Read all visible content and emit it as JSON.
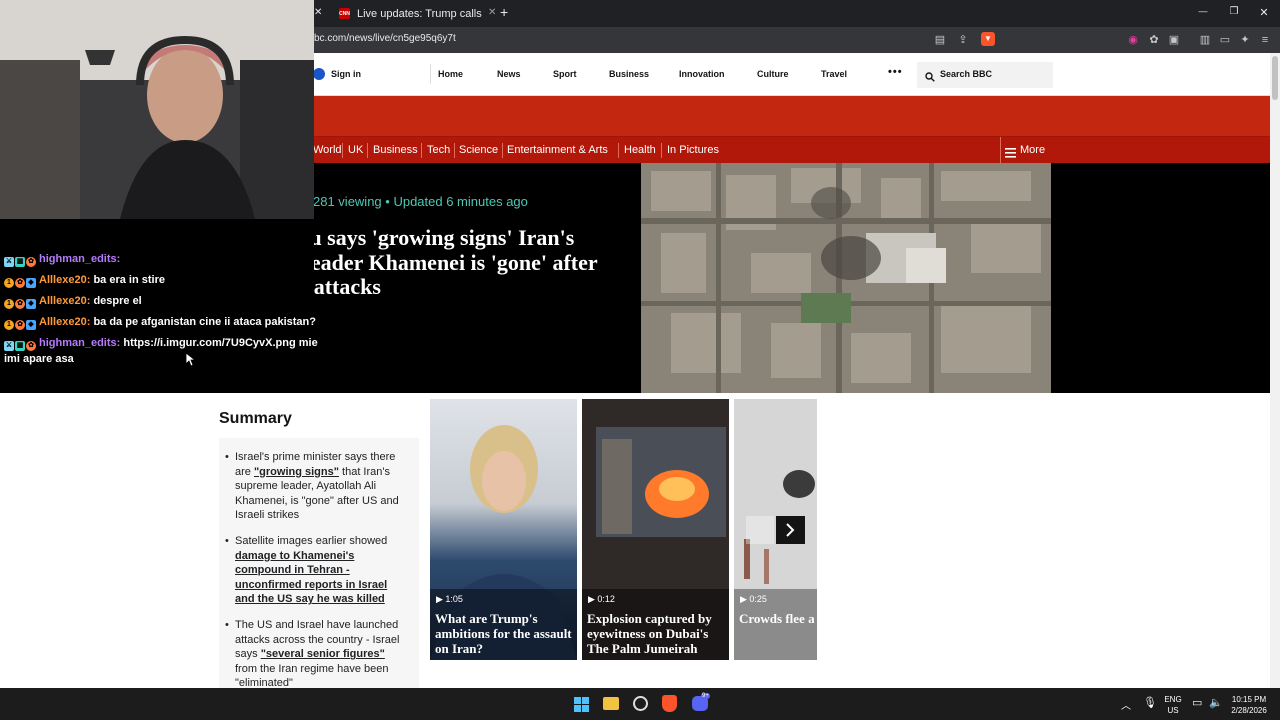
{
  "browser": {
    "tabs": [
      {
        "label": "Live updates: Trump calls for regime"
      }
    ],
    "new_tab_label": "+",
    "url": "bc.com/news/live/cn5ge95q6y7t",
    "window_controls": {
      "minimize": "—",
      "restore": "❐",
      "close": "✕"
    }
  },
  "bbc": {
    "sign_in": "Sign in",
    "nav": [
      "Home",
      "News",
      "Sport",
      "Business",
      "Innovation",
      "Culture",
      "Travel"
    ],
    "more_dots": "•••",
    "search_placeholder": "Search BBC",
    "subnav": [
      "World",
      "UK",
      "Business",
      "Tech",
      "Science",
      "Entertainment & Arts",
      "Health",
      "In Pictures"
    ],
    "more_label": "More",
    "viewing": "281 viewing",
    "updated": "Updated 6 minutes ago",
    "headline": "Netanyahu says 'growing signs' Iran's supreme leader Khamenei is 'gone' after US-Israel attacks",
    "summary_title": "Summary",
    "summary_bullets": [
      {
        "before": "Israel's prime minister says there are ",
        "link": "\"growing signs\"",
        "after": " that Iran's supreme leader, Ayatollah Ali Khamenei, is \"gone\" after US and Israeli strikes"
      },
      {
        "before": "Satellite images earlier showed ",
        "link": "damage to Khamenei's compound in Tehran - unconfirmed reports in Israel and the US say he was killed",
        "after": ""
      },
      {
        "before": "The US and Israel have launched attacks across the country - Israel says ",
        "link": "\"several senior figures\"",
        "after": " from the Iran regime have been \"eliminated\""
      }
    ],
    "videos": [
      {
        "duration": "1:05",
        "title": "What are Trump's ambitions for the assault on Iran?"
      },
      {
        "duration": "0:12",
        "title": "Explosion captured by eyewitness on Dubai's The Palm Jumeirah"
      },
      {
        "duration": "0:25",
        "title": "Crowds flee a object sparks in Doha"
      }
    ]
  },
  "chat": {
    "messages": [
      {
        "user": "highman_edits:",
        "text": "",
        "color": "#b57bff"
      },
      {
        "user": "Alllexe20:",
        "text": "ba era in stire",
        "color": "#ff9a3c"
      },
      {
        "user": "Alllexe20:",
        "text": "despre el",
        "color": "#ff9a3c"
      },
      {
        "user": "Alllexe20:",
        "text": "ba da pe afganistan cine ii ataca pakistan?",
        "color": "#ff9a3c"
      },
      {
        "user": "highman_edits:",
        "text": "https://i.imgur.com/7U9CyvX.png mie",
        "color": "#b57bff"
      }
    ],
    "continuation": "imi apare asa"
  },
  "taskbar": {
    "lang_top": "ENG",
    "lang_bottom": "US",
    "time": "10:15 PM",
    "date": "2/28/2026",
    "discord_badge": "9+"
  },
  "colors": {
    "bbc_red": "#c4270f",
    "bbc_red_dark": "#b1180a",
    "live_teal": "#4ec7b4"
  }
}
